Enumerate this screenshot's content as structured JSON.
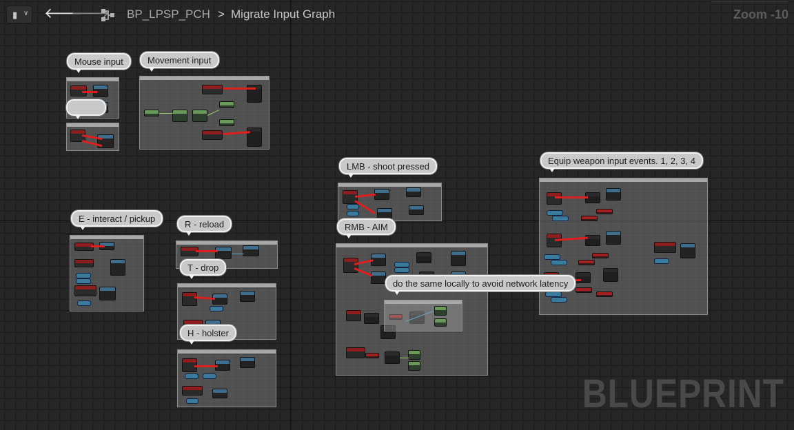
{
  "toolbar": {
    "bookmark_icon": "bookmark-icon",
    "bookmark_chevron": "chevron-down-icon",
    "back_glyph": "🡐",
    "forward_glyph": "🡒",
    "graph_icon": "graph-hierarchy-icon",
    "blueprint_name": "BP_LPSP_PCH",
    "separator": ">",
    "graph_name": "Migrate Input Graph",
    "zoom": "Zoom -10"
  },
  "comments": [
    {
      "id": "mouse",
      "label": "Mouse input"
    },
    {
      "id": "movement",
      "label": "Movement input"
    },
    {
      "id": "lmb",
      "label": "LMB - shoot pressed"
    },
    {
      "id": "equip",
      "label": "Equip weapon input events. 1, 2, 3, 4"
    },
    {
      "id": "interact",
      "label": "E - interact / pickup"
    },
    {
      "id": "reload",
      "label": "R - reload"
    },
    {
      "id": "drop",
      "label": "T - drop"
    },
    {
      "id": "rmb",
      "label": "RMB - AIM"
    },
    {
      "id": "holster",
      "label": "H - holster"
    },
    {
      "id": "local",
      "label": "do the same locally to avoid network latency"
    }
  ],
  "watermark": "BLUEPRINT",
  "colors": {
    "background": "#262626",
    "event_header": "#8e1e1e",
    "function_header": "#3f6d8e",
    "exec_wire": "#e11e1e"
  }
}
